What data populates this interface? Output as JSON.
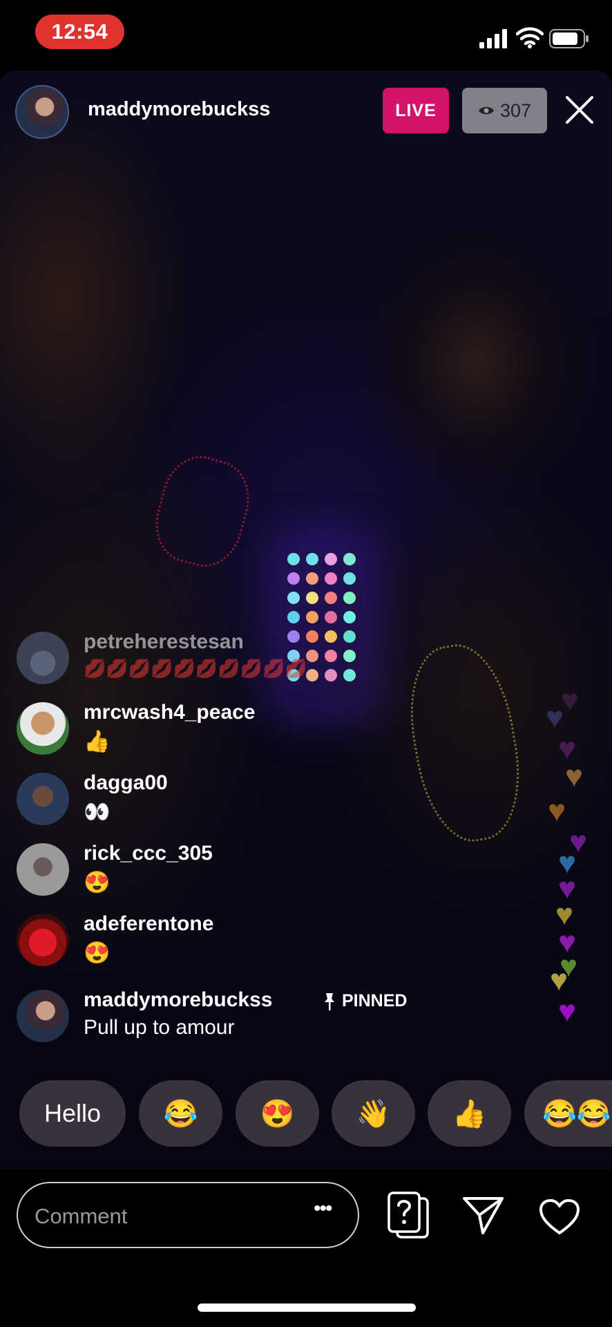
{
  "status_bar": {
    "time": "12:54"
  },
  "header": {
    "host_username": "maddymorebuckss",
    "live_label": "LIVE",
    "viewer_count": "307"
  },
  "comments": [
    {
      "username": "petreherestesan",
      "text": "💋💋💋💋💋💋💋💋💋💋"
    },
    {
      "username": "mrcwash4_peace",
      "text": "👍"
    },
    {
      "username": "dagga00",
      "text": "👀"
    },
    {
      "username": "rick_ccc_305",
      "text": "😍"
    },
    {
      "username": "adeferentone",
      "text": "😍"
    },
    {
      "username": "maddymorebuckss",
      "text": "Pull up to amour",
      "pinned_label": "PINNED"
    }
  ],
  "quick_replies": [
    "Hello",
    "😂",
    "😍",
    "👋",
    "👍",
    "😂😂"
  ],
  "comment_input": {
    "placeholder": "Comment"
  },
  "icons": [
    "signal-icon",
    "wifi-icon",
    "battery-icon",
    "eye-icon",
    "close-icon",
    "pin-icon",
    "more-icon",
    "question-icon",
    "send-icon",
    "heart-icon"
  ],
  "colors": {
    "live_badge": "#d4146a",
    "time_pill": "#e0332f",
    "viewer_badge": "#9696a0"
  }
}
